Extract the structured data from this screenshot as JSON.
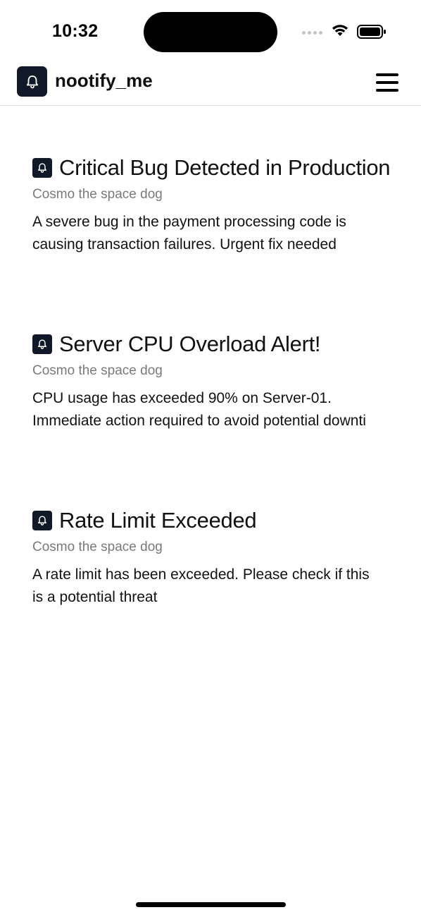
{
  "status_bar": {
    "time": "10:32"
  },
  "header": {
    "app_title": "nootify_me",
    "logo_icon": "bell-icon",
    "menu_icon": "hamburger-menu-icon"
  },
  "notifications": [
    {
      "title": "Critical Bug Detected in Production",
      "author": "Cosmo the space dog",
      "body_line1": "A severe bug in the payment processing code is",
      "body_line2": "causing transaction failures. Urgent fix needed"
    },
    {
      "title": "Server CPU Overload Alert!",
      "author": "Cosmo the space dog",
      "body_line1": "CPU usage has exceeded 90% on Server-01.",
      "body_line2": "Immediate action required to avoid potential downti"
    },
    {
      "title": "Rate Limit Exceeded",
      "author": "Cosmo the space dog",
      "body_line1": "A rate limit has been exceeded. Please check if this",
      "body_line2": "is a potential threat"
    }
  ],
  "colors": {
    "accent_dark": "#111827",
    "muted_text": "#7a7a7a",
    "divider": "#e2e2e2"
  }
}
